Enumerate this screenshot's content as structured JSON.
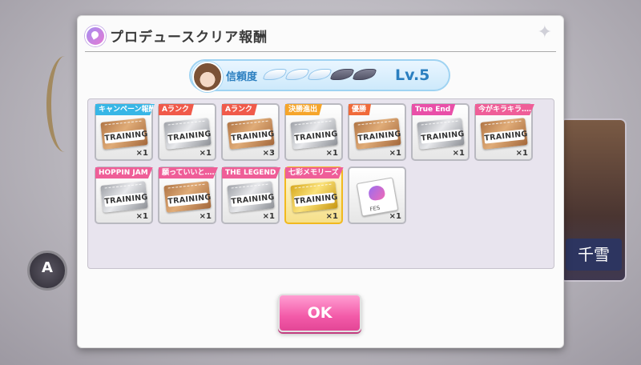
{
  "background": {
    "rank_badge": "A",
    "character_name": "千雪"
  },
  "dialog": {
    "title": "プロデュースクリア報酬",
    "header_icon": "producer-badge-icon",
    "sparkle_icon": "sparkle-icon"
  },
  "trust": {
    "label": "信頼度",
    "wings_total": 5,
    "wings_filled": 3,
    "level": "Lv.5"
  },
  "rewards": [
    {
      "label": "キャンペーン報酬",
      "label_color": "#37b6e6",
      "ticket": "bronze",
      "ticket_text": "TRAINING",
      "qty": "×1",
      "frame": "normal"
    },
    {
      "label": "Aランク",
      "label_color": "#f05a4a",
      "ticket": "silver",
      "ticket_text": "TRAINING",
      "qty": "×1",
      "frame": "normal"
    },
    {
      "label": "Aランク",
      "label_color": "#f05a4a",
      "ticket": "bronze",
      "ticket_text": "TRAINING",
      "qty": "×3",
      "frame": "normal"
    },
    {
      "label": "決勝進出",
      "label_color": "#f6a52a",
      "ticket": "silver",
      "ticket_text": "TRAINING",
      "qty": "×1",
      "frame": "normal"
    },
    {
      "label": "優勝",
      "label_color": "#f06a3a",
      "ticket": "bronze",
      "ticket_text": "TRAINING",
      "qty": "×1",
      "frame": "normal"
    },
    {
      "label": "True End",
      "label_color": "#e94fa8",
      "ticket": "silver",
      "ticket_text": "TRAINING",
      "qty": "×1",
      "frame": "normal"
    },
    {
      "label": "今がキラキラ……",
      "label_color": "#ef5e98",
      "ticket": "bronze",
      "ticket_text": "TRAINING",
      "qty": "×1",
      "frame": "normal"
    },
    {
      "label": "HOPPIN JAM",
      "label_color": "#ef5e98",
      "ticket": "silver",
      "ticket_text": "TRAINING",
      "qty": "×1",
      "frame": "normal"
    },
    {
      "label": "願っていいと……",
      "label_color": "#ef5e98",
      "ticket": "bronze",
      "ticket_text": "TRAINING",
      "qty": "×1",
      "frame": "normal"
    },
    {
      "label": "THE LEGEND",
      "label_color": "#ef5e98",
      "ticket": "silver",
      "ticket_text": "TRAINING",
      "qty": "×1",
      "frame": "normal"
    },
    {
      "label": "七彩メモリーズ",
      "label_color": "#ef5e98",
      "ticket": "gold",
      "ticket_text": "TRAINING",
      "qty": "×1",
      "frame": "gold"
    },
    {
      "label": "",
      "label_color": "",
      "ticket": "fes",
      "ticket_text": "FES",
      "qty": "×1",
      "frame": "normal"
    }
  ],
  "ok_button": {
    "label": "OK"
  }
}
